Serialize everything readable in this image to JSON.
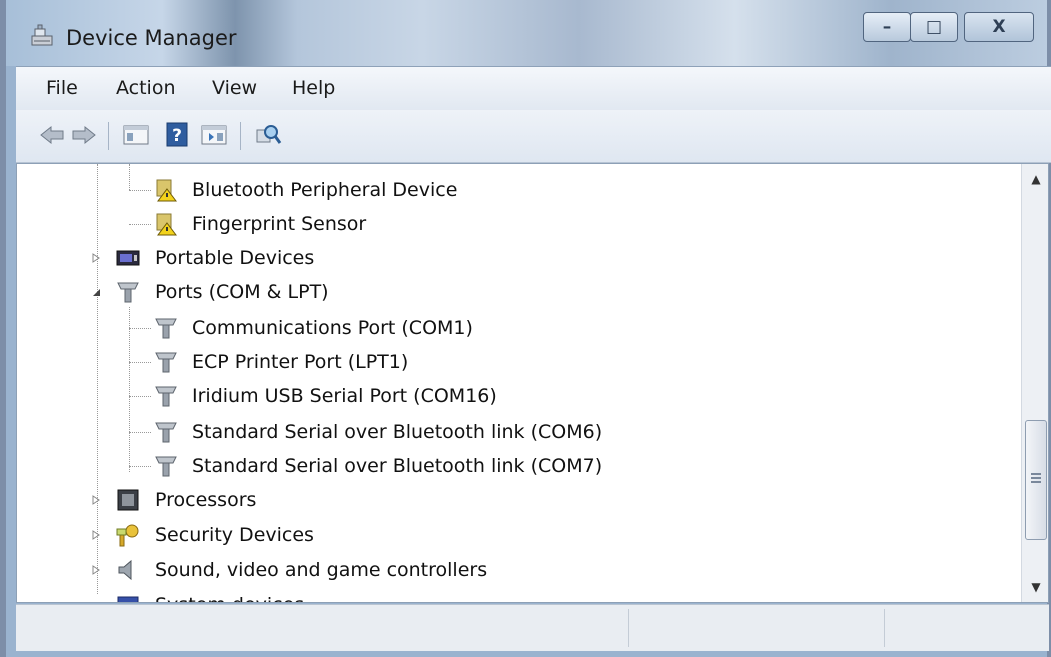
{
  "window": {
    "title": "Device Manager",
    "controls": {
      "minimize": "–",
      "maximize": "□",
      "close": "X"
    }
  },
  "menubar": {
    "items": [
      "File",
      "Action",
      "View",
      "Help"
    ]
  },
  "toolbar": {
    "buttons": [
      "back-arrow-icon",
      "forward-arrow-icon",
      "show-hide-console-tree-icon",
      "help-icon",
      "show-action-pane-icon",
      "scan-hardware-icon"
    ]
  },
  "tree": {
    "items": [
      {
        "label": "Bluetooth Peripheral Device",
        "level": 2,
        "icon": "warning-device-icon"
      },
      {
        "label": "Fingerprint Sensor",
        "level": 2,
        "icon": "warning-device-icon"
      },
      {
        "label": "Portable Devices",
        "level": 1,
        "icon": "portable-device-icon",
        "state": "collapsed"
      },
      {
        "label": "Ports (COM & LPT)",
        "level": 1,
        "icon": "port-icon",
        "state": "expanded"
      },
      {
        "label": "Communications Port (COM1)",
        "level": 2,
        "icon": "port-icon"
      },
      {
        "label": "ECP Printer Port (LPT1)",
        "level": 2,
        "icon": "port-icon"
      },
      {
        "label": "Iridium USB Serial Port (COM16)",
        "level": 2,
        "icon": "port-icon"
      },
      {
        "label": "Standard Serial over Bluetooth link (COM6)",
        "level": 2,
        "icon": "port-icon"
      },
      {
        "label": "Standard Serial over Bluetooth link (COM7)",
        "level": 2,
        "icon": "port-icon"
      },
      {
        "label": "Processors",
        "level": 1,
        "icon": "processor-icon",
        "state": "collapsed"
      },
      {
        "label": "Security Devices",
        "level": 1,
        "icon": "security-key-icon",
        "state": "collapsed"
      },
      {
        "label": "Sound, video and game controllers",
        "level": 1,
        "icon": "speaker-icon",
        "state": "collapsed"
      },
      {
        "label": "System devices",
        "level": 1,
        "icon": "system-device-icon",
        "state": "collapsed"
      }
    ]
  },
  "scrollbar": {
    "up": "▲",
    "down": "▼"
  }
}
